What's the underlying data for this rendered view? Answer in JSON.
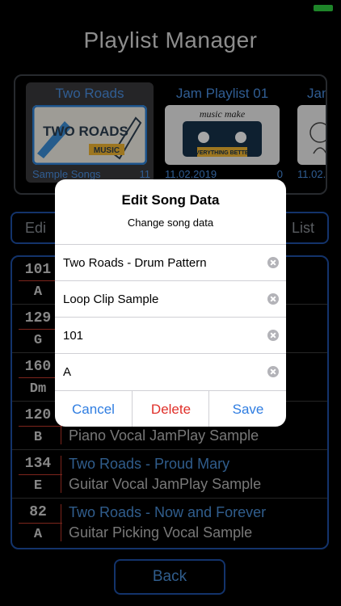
{
  "app": {
    "title": "Playlist Manager"
  },
  "playlists": [
    {
      "name": "Two Roads",
      "meta": "Sample Songs",
      "count": "11",
      "selected": true,
      "thumb_text": "TWO ROADS",
      "thumb_tag": "MUSIC"
    },
    {
      "name": "Jam Playlist 01",
      "meta": "11.02.2019",
      "count": "0",
      "selected": false,
      "thumb_text": "music make",
      "thumb_tag": "EVERYTHING BETTER"
    },
    {
      "name": "Jam",
      "meta": "11.02.",
      "count": "",
      "selected": false
    }
  ],
  "buttons": {
    "edit_label": "Edi",
    "list_label": "List",
    "back_label": "Back"
  },
  "songs": [
    {
      "bpm": "101",
      "key": "A",
      "title": "",
      "desc": ""
    },
    {
      "bpm": "129",
      "key": "G",
      "title": "",
      "desc": ""
    },
    {
      "bpm": "160",
      "key": "Dm",
      "title": "",
      "desc": ""
    },
    {
      "bpm": "120",
      "key": "B",
      "title": "",
      "desc": "Piano Vocal JamPlay Sample"
    },
    {
      "bpm": "134",
      "key": "E",
      "title": "Two Roads - Proud Mary",
      "desc": "Guitar Vocal JamPlay Sample"
    },
    {
      "bpm": "82",
      "key": "A",
      "title": "Two Roads - Now and Forever",
      "desc": "Guitar Picking Vocal Sample"
    }
  ],
  "dialog": {
    "title": "Edit Song Data",
    "message": "Change song data",
    "fields": [
      "Two Roads - Drum Pattern",
      "Loop Clip Sample",
      "101",
      "A"
    ],
    "cancel": "Cancel",
    "delete": "Delete",
    "save": "Save"
  },
  "colors": {
    "accent": "#4a90e2",
    "destructive": "#e0302a",
    "action": "#2f7de1"
  }
}
